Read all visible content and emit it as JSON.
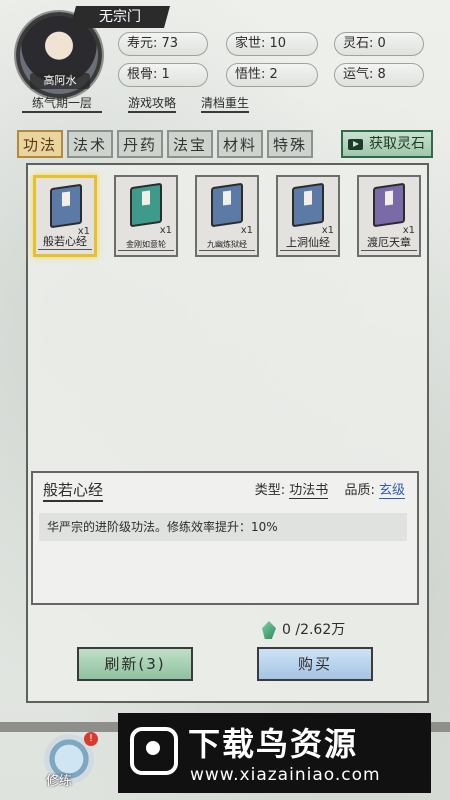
{
  "header": {
    "sect": "无宗门",
    "avatar_name": "高阿水",
    "realm": "练气期一层",
    "stats": [
      {
        "label": "寿元: 73"
      },
      {
        "label": "家世: 10"
      },
      {
        "label": "灵石: 0"
      },
      {
        "label": "根骨: 1"
      },
      {
        "label": "悟性: 2"
      },
      {
        "label": "运气: 8"
      }
    ],
    "links": {
      "guide": "游戏攻略",
      "reset": "清档重生"
    }
  },
  "tabs": [
    {
      "label": "功法",
      "active": true
    },
    {
      "label": "法术"
    },
    {
      "label": "丹药"
    },
    {
      "label": "法宝"
    },
    {
      "label": "材料"
    },
    {
      "label": "特殊"
    }
  ],
  "get_stones_label": "获取灵石",
  "items": [
    {
      "name": "般若心经",
      "qty": "x1",
      "color": "#5b7aa6",
      "selected": true
    },
    {
      "name": "金刚如意轮",
      "qty": "x1",
      "color": "#3e9a8a"
    },
    {
      "name": "九幽炼狱经",
      "qty": "x1",
      "color": "#5b7aa6"
    },
    {
      "name": "上洞仙经",
      "qty": "x1",
      "color": "#5b7aa6"
    },
    {
      "name": "渡厄天章",
      "qty": "x1",
      "color": "#7a6aa8"
    }
  ],
  "detail": {
    "title": "般若心经",
    "type_label": "类型:",
    "type_value": "功法书",
    "quality_label": "品质:",
    "quality_value": "玄级",
    "description": "华严宗的进阶级功法。修练效率提升：10%"
  },
  "cost": "0 /2.62万",
  "buttons": {
    "refresh": "刷新(3)",
    "buy": "购买"
  },
  "nav": {
    "xiulian": "修练",
    "badge": "!"
  },
  "watermark": {
    "title": "下载鸟资源",
    "url": "www.xiazainiao.com"
  }
}
